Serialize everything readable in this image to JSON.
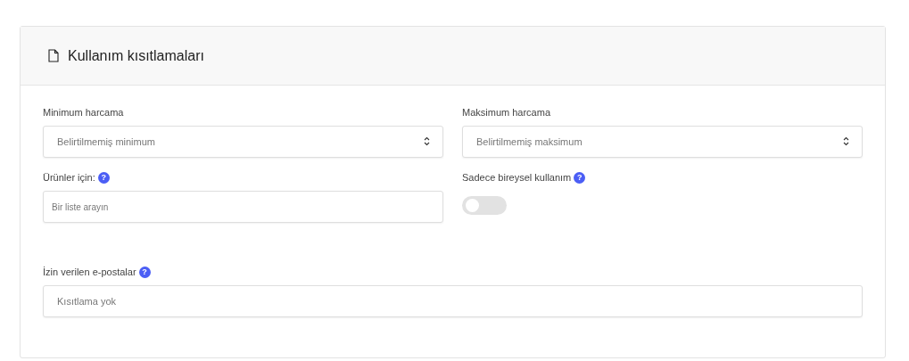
{
  "card": {
    "title": "Kullanım kısıtlamaları"
  },
  "fields": [
    {
      "kind": "number",
      "label": "Minimum harcama",
      "placeholder": "Belirtilmemiş minimum"
    },
    {
      "kind": "number",
      "label": "Maksimum harcama",
      "placeholder": "Belirtilmemiş maksimum"
    },
    {
      "kind": "search",
      "label": "Ürünler için:",
      "help": "?",
      "placeholder": "Bir liste arayın"
    },
    {
      "kind": "toggle",
      "label": "Sadece bireysel kullanım",
      "help": "?",
      "on": false
    },
    {
      "kind": "text",
      "label": "İzin verilen e-postalar",
      "help": "?",
      "placeholder": "Kısıtlama yok"
    }
  ]
}
